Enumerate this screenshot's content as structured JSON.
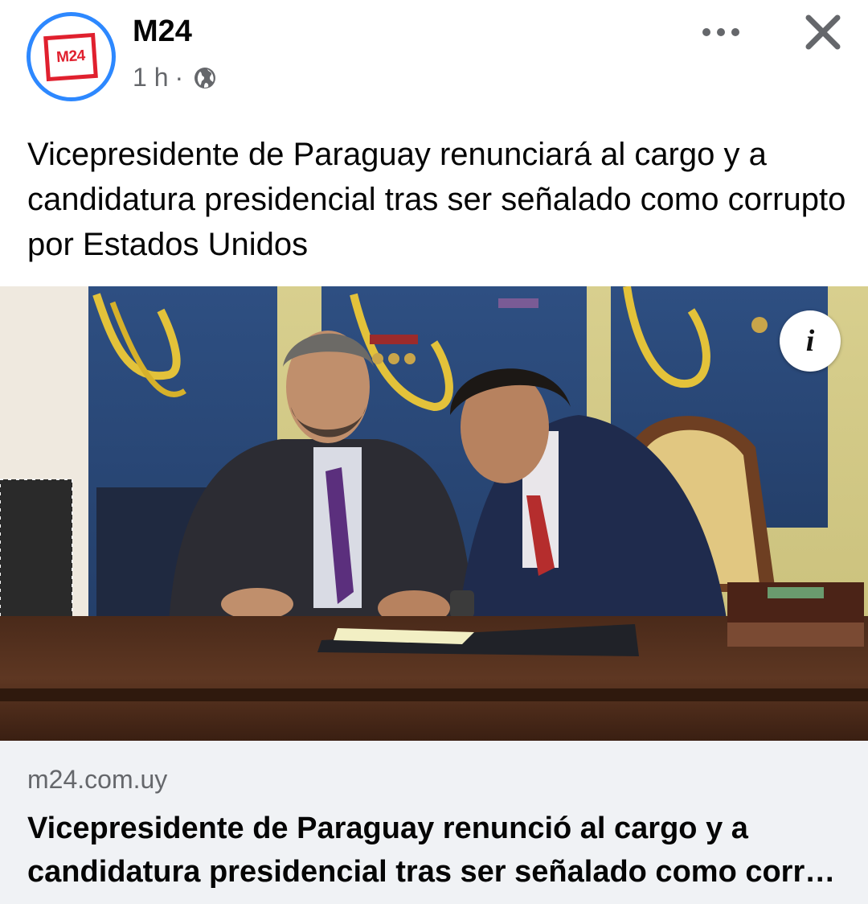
{
  "post": {
    "page_name": "M24",
    "avatar_text": "M24",
    "time": "1 h",
    "separator": "·",
    "audience_icon": "globe-icon",
    "text": "Vicepresidente de Paraguay renunciará al cargo y a candidatura presidencial tras ser señalado como corrupto por Estados Unidos"
  },
  "actions": {
    "more_icon": "more-options-icon",
    "close_icon": "close-icon"
  },
  "image": {
    "info_label": "i"
  },
  "link": {
    "domain": "m24.com.uy",
    "title_line1": "Vicepresidente de Paraguay renunció al cargo y a",
    "title_line2": "candidatura presidencial tras ser señalado como corr…"
  },
  "colors": {
    "accent": "#2d88ff",
    "brand_red": "#e0202e",
    "secondary_text": "#65676b",
    "preview_bg": "#f0f2f5"
  }
}
